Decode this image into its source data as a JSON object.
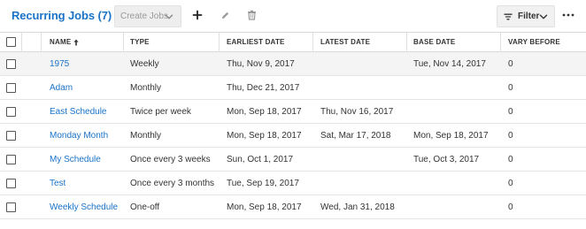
{
  "toolbar": {
    "title": "Recurring Jobs (7)",
    "create_label": "Create Jobs",
    "filter_label": "Filter"
  },
  "columns": {
    "name": "NAME",
    "type": "TYPE",
    "earliest": "EARLIEST DATE",
    "latest": "LATEST DATE",
    "base": "BASE DATE",
    "vary": "VARY BEFORE"
  },
  "rows": [
    {
      "name": "1975",
      "type": "Weekly",
      "earliest": "Thu, Nov 9, 2017",
      "latest": "",
      "base": "Tue, Nov 14, 2017",
      "vary": "0"
    },
    {
      "name": "Adam",
      "type": "Monthly",
      "earliest": "Thu, Dec 21, 2017",
      "latest": "",
      "base": "",
      "vary": "0"
    },
    {
      "name": "East Schedule",
      "type": "Twice per week",
      "earliest": "Mon, Sep 18, 2017",
      "latest": "Thu, Nov 16, 2017",
      "base": "",
      "vary": "0"
    },
    {
      "name": "Monday Month",
      "type": "Monthly",
      "earliest": "Mon, Sep 18, 2017",
      "latest": "Sat, Mar 17, 2018",
      "base": "Mon, Sep 18, 2017",
      "vary": "0"
    },
    {
      "name": "My Schedule",
      "type": "Once every 3 weeks",
      "earliest": "Sun, Oct 1, 2017",
      "latest": "",
      "base": "Tue, Oct 3, 2017",
      "vary": "0"
    },
    {
      "name": "Test",
      "type": "Once every 3 months",
      "earliest": "Tue, Sep 19, 2017",
      "latest": "",
      "base": "",
      "vary": "0"
    },
    {
      "name": "Weekly Schedule",
      "type": "One-off",
      "earliest": "Mon, Sep 18, 2017",
      "latest": "Wed, Jan 31, 2018",
      "base": "",
      "vary": "0"
    }
  ],
  "icons": {
    "title_chevron": "chevron-down-icon",
    "create_chevron": "chevron-down-icon",
    "add": "plus-icon",
    "edit": "pencil-icon",
    "delete": "trash-icon",
    "filter": "filter-icon",
    "filter_chevron": "chevron-down-icon",
    "more": "more-horizontal-icon",
    "sort": "arrow-up-icon"
  },
  "colors": {
    "accent": "#1a73c8",
    "selected_row": "#f4f4f4"
  }
}
